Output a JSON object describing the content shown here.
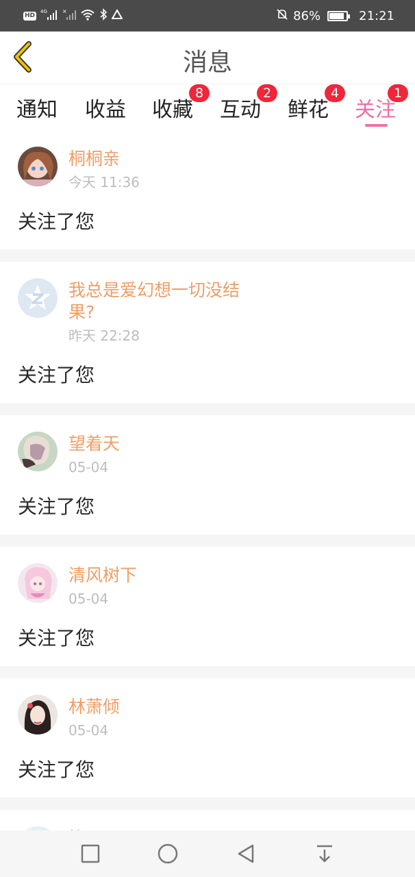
{
  "status_bar": {
    "network_badge": "HD",
    "network_type": "4G",
    "battery_percent": "86%",
    "time": "21:21",
    "battery_level": 0.86
  },
  "header": {
    "title": "消息",
    "back_icon": "chevron-left-icon"
  },
  "tabs": [
    {
      "label": "通知",
      "badge": ""
    },
    {
      "label": "收益",
      "badge": ""
    },
    {
      "label": "收藏",
      "badge": "8"
    },
    {
      "label": "互动",
      "badge": "2"
    },
    {
      "label": "鲜花",
      "badge": "4"
    },
    {
      "label": "关注",
      "badge": "1",
      "active": true
    }
  ],
  "colors": {
    "accent": "#ee6fa6",
    "username": "#ef9e66",
    "badge": "#f0263a",
    "status_bar": "#4a4a4a"
  },
  "items": [
    {
      "username": "桐桐亲",
      "time": "今天 11:36",
      "message": "关注了您",
      "avatar": "anime-girl-avatar"
    },
    {
      "username": "我总是爱幻想一切没结果?",
      "time": "昨天 22:28",
      "message": "关注了您",
      "avatar": "default-z-avatar"
    },
    {
      "username": "望着天",
      "time": "05-04",
      "message": "关注了您",
      "avatar": "anime-avatar"
    },
    {
      "username": "清风树下",
      "time": "05-04",
      "message": "关注了您",
      "avatar": "pink-anime-avatar"
    },
    {
      "username": "林萧倾",
      "time": "05-04",
      "message": "关注了您",
      "avatar": "girl-portrait-avatar"
    },
    {
      "username": "柳",
      "time": "",
      "message": "",
      "avatar": "teal-anime-avatar"
    }
  ],
  "nav_bar": [
    "recent-apps-icon",
    "home-icon",
    "back-icon",
    "notification-pull-icon"
  ]
}
